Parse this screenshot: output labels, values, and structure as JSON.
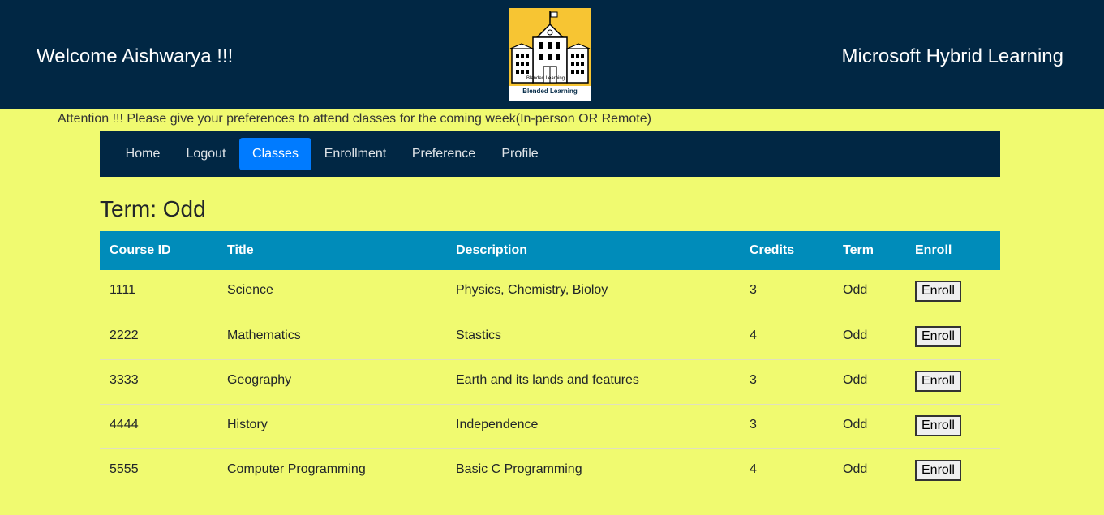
{
  "header": {
    "welcome": "Welcome Aishwarya !!!",
    "brand": "Microsoft Hybrid Learning",
    "logo_caption": "Blended Learning",
    "logo_small_text": "Blended Learning"
  },
  "attention": "Attention !!! Please give your preferences to attend classes for the coming week(In-person OR Remote)",
  "nav": {
    "items": [
      {
        "label": "Home",
        "active": false
      },
      {
        "label": "Logout",
        "active": false
      },
      {
        "label": "Classes",
        "active": true
      },
      {
        "label": "Enrollment",
        "active": false
      },
      {
        "label": "Preference",
        "active": false
      },
      {
        "label": "Profile",
        "active": false
      }
    ]
  },
  "term_heading": "Term: Odd",
  "table": {
    "headers": [
      "Course ID",
      "Title",
      "Description",
      "Credits",
      "Term",
      "Enroll"
    ],
    "rows": [
      {
        "id": "1111",
        "title": "Science",
        "description": "Physics, Chemistry, Bioloy",
        "credits": "3",
        "term": "Odd",
        "enroll": "Enroll"
      },
      {
        "id": "2222",
        "title": "Mathematics",
        "description": "Stastics",
        "credits": "4",
        "term": "Odd",
        "enroll": "Enroll"
      },
      {
        "id": "3333",
        "title": "Geography",
        "description": "Earth and its lands and features",
        "credits": "3",
        "term": "Odd",
        "enroll": "Enroll"
      },
      {
        "id": "4444",
        "title": "History",
        "description": "Independence",
        "credits": "3",
        "term": "Odd",
        "enroll": "Enroll"
      },
      {
        "id": "5555",
        "title": "Computer Programming",
        "description": "Basic C Programming",
        "credits": "4",
        "term": "Odd",
        "enroll": "Enroll"
      }
    ]
  },
  "colors": {
    "header_bg": "#012744",
    "page_bg": "#f0fa70",
    "table_header_bg": "#008cba",
    "active_nav": "#007bff"
  }
}
